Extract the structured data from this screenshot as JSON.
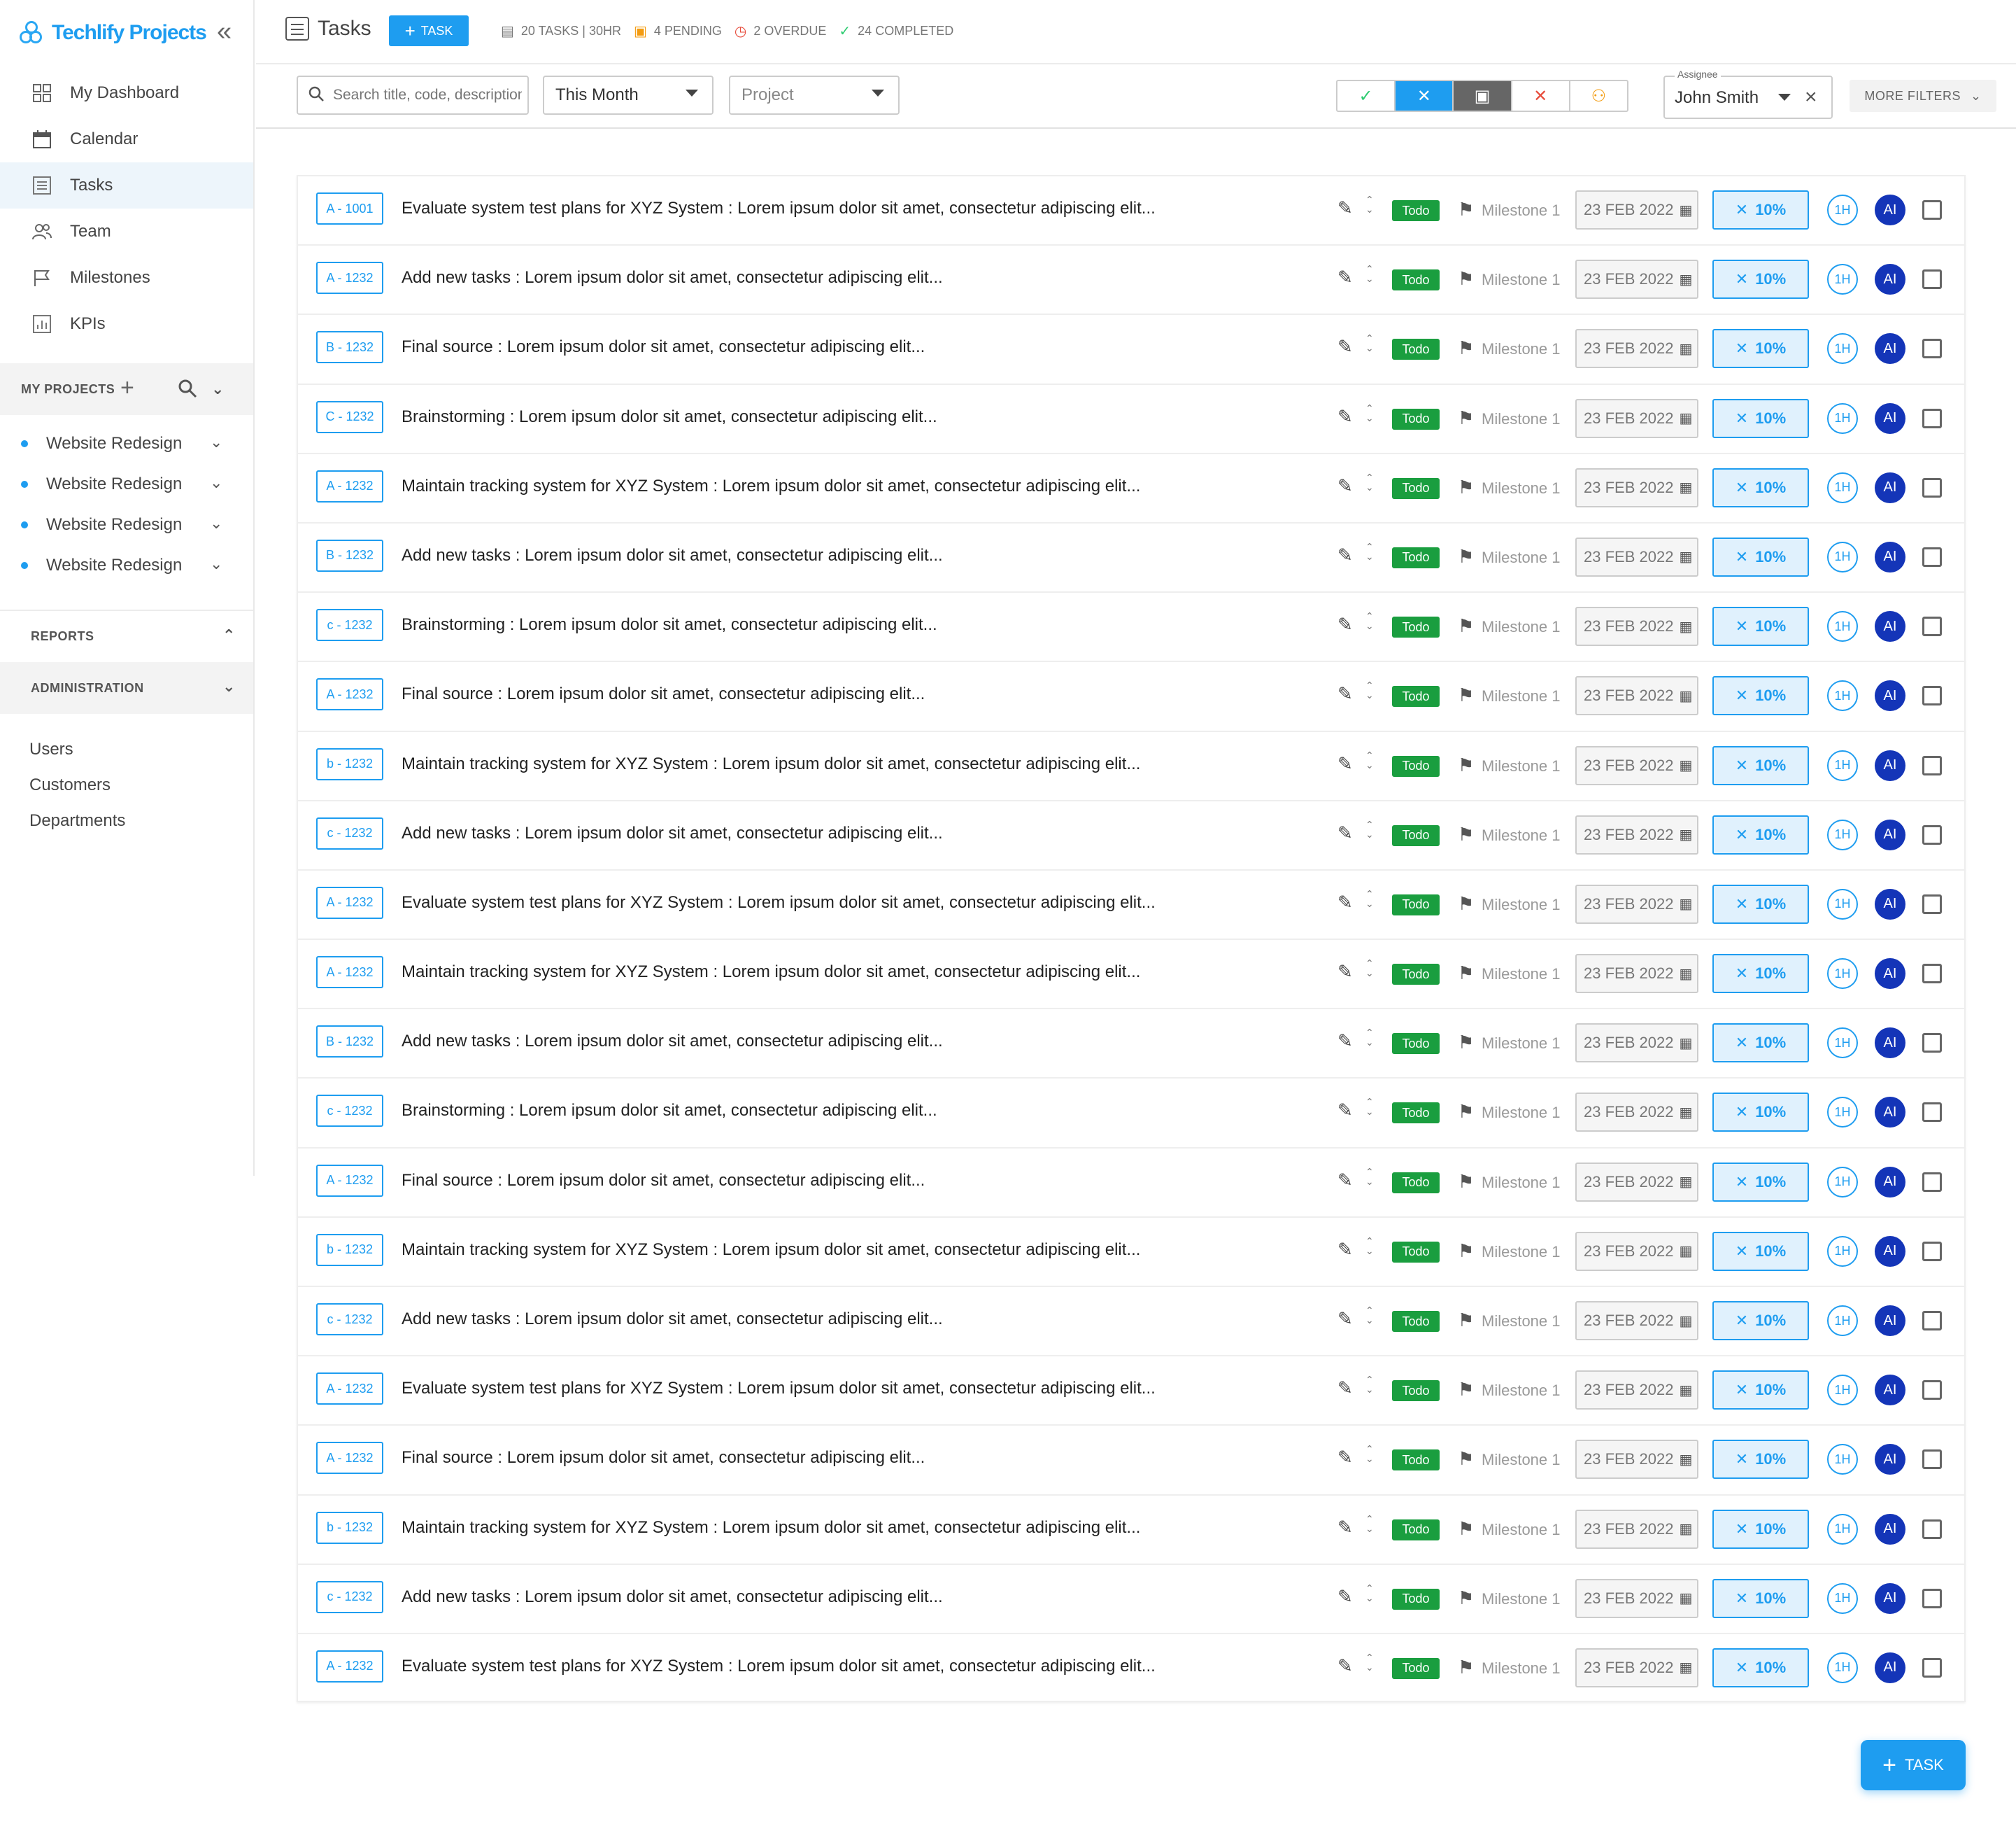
{
  "brand": {
    "name": "Techlify Projects"
  },
  "nav": [
    {
      "label": "My Dashboard",
      "icon": "dashboard-icon"
    },
    {
      "label": "Calendar",
      "icon": "calendar-icon"
    },
    {
      "label": "Tasks",
      "icon": "tasks-icon",
      "active": true
    },
    {
      "label": "Team",
      "icon": "team-icon"
    },
    {
      "label": "Milestones",
      "icon": "milestone-flag-icon"
    },
    {
      "label": "KPIs",
      "icon": "kpi-chart-icon"
    }
  ],
  "my_projects": {
    "label": "MY PROJECTS",
    "items": [
      "Website Redesign",
      "Website Redesign",
      "Website Redesign",
      "Website Redesign"
    ]
  },
  "reports": {
    "label": "REPORTS"
  },
  "administration": {
    "label": "ADMINISTRATION",
    "links": [
      "Users",
      "Customers",
      "Departments"
    ]
  },
  "header": {
    "title": "Tasks",
    "add_task_label": "TASK",
    "stats": {
      "tasks": "20 TASKS | 30HR",
      "pending": "4 PENDING",
      "overdue": "2 OVERDUE",
      "completed": "24 COMPLETED"
    }
  },
  "filters": {
    "search_placeholder": "Search title, code, description",
    "period": "This Month",
    "project_placeholder": "Project",
    "assignee_label": "Assignee",
    "assignee_value": "John Smith",
    "more_filters": "MORE FILTERS"
  },
  "tasks": [
    {
      "code": "A - 1001",
      "title": "Evaluate system test plans for XYZ System : Lorem ipsum dolor sit amet, consectetur adipiscing elit...",
      "status": "Todo",
      "milestone": "Milestone 1",
      "date": "23 FEB 2022",
      "progress": "10%",
      "hours": "1H",
      "assignee": "AI"
    },
    {
      "code": "A - 1232",
      "title": "Add new tasks : Lorem ipsum dolor sit amet, consectetur adipiscing elit...",
      "status": "Todo",
      "milestone": "Milestone 1",
      "date": "23 FEB 2022",
      "progress": "10%",
      "hours": "1H",
      "assignee": "AI"
    },
    {
      "code": "B - 1232",
      "title": "Final source  : Lorem ipsum dolor sit amet, consectetur adipiscing elit...",
      "status": "Todo",
      "milestone": "Milestone 1",
      "date": "23 FEB 2022",
      "progress": "10%",
      "hours": "1H",
      "assignee": "AI"
    },
    {
      "code": "C - 1232",
      "title": "Brainstorming : Lorem ipsum dolor sit amet, consectetur adipiscing elit...",
      "status": "Todo",
      "milestone": "Milestone 1",
      "date": "23 FEB 2022",
      "progress": "10%",
      "hours": "1H",
      "assignee": "AI"
    },
    {
      "code": "A - 1232",
      "title": "Maintain tracking system for XYZ System : Lorem ipsum dolor sit amet, consectetur adipiscing elit...",
      "status": "Todo",
      "milestone": "Milestone 1",
      "date": "23 FEB 2022",
      "progress": "10%",
      "hours": "1H",
      "assignee": "AI"
    },
    {
      "code": "B - 1232",
      "title": "Add new tasks  : Lorem ipsum dolor sit amet, consectetur adipiscing elit...",
      "status": "Todo",
      "milestone": "Milestone 1",
      "date": "23 FEB 2022",
      "progress": "10%",
      "hours": "1H",
      "assignee": "AI"
    },
    {
      "code": "c - 1232",
      "title": "Brainstorming : Lorem ipsum dolor sit amet, consectetur adipiscing elit...",
      "status": "Todo",
      "milestone": "Milestone 1",
      "date": "23 FEB 2022",
      "progress": "10%",
      "hours": "1H",
      "assignee": "AI"
    },
    {
      "code": "A - 1232",
      "title": "Final source  : Lorem ipsum dolor sit amet, consectetur adipiscing elit...",
      "status": "Todo",
      "milestone": "Milestone 1",
      "date": "23 FEB 2022",
      "progress": "10%",
      "hours": "1H",
      "assignee": "AI"
    },
    {
      "code": "b - 1232",
      "title": "Maintain tracking system for XYZ System : Lorem ipsum dolor sit amet, consectetur adipiscing elit...",
      "status": "Todo",
      "milestone": "Milestone 1",
      "date": "23 FEB 2022",
      "progress": "10%",
      "hours": "1H",
      "assignee": "AI"
    },
    {
      "code": "c - 1232",
      "title": "Add new tasks : Lorem ipsum dolor sit amet, consectetur adipiscing elit...",
      "status": "Todo",
      "milestone": "Milestone 1",
      "date": "23 FEB 2022",
      "progress": "10%",
      "hours": "1H",
      "assignee": "AI"
    },
    {
      "code": "A - 1232",
      "title": "Evaluate system test plans for XYZ System : Lorem ipsum dolor sit amet, consectetur adipiscing elit...",
      "status": "Todo",
      "milestone": "Milestone 1",
      "date": "23 FEB 2022",
      "progress": "10%",
      "hours": "1H",
      "assignee": "AI"
    },
    {
      "code": "A - 1232",
      "title": "Maintain tracking system for XYZ System : Lorem ipsum dolor sit amet, consectetur adipiscing elit...",
      "status": "Todo",
      "milestone": "Milestone 1",
      "date": "23 FEB 2022",
      "progress": "10%",
      "hours": "1H",
      "assignee": "AI"
    },
    {
      "code": "B - 1232",
      "title": "Add new tasks  : Lorem ipsum dolor sit amet, consectetur adipiscing elit...",
      "status": "Todo",
      "milestone": "Milestone 1",
      "date": "23 FEB 2022",
      "progress": "10%",
      "hours": "1H",
      "assignee": "AI"
    },
    {
      "code": "c - 1232",
      "title": "Brainstorming : Lorem ipsum dolor sit amet, consectetur adipiscing elit...",
      "status": "Todo",
      "milestone": "Milestone 1",
      "date": "23 FEB 2022",
      "progress": "10%",
      "hours": "1H",
      "assignee": "AI"
    },
    {
      "code": "A - 1232",
      "title": "Final source  : Lorem ipsum dolor sit amet, consectetur adipiscing elit...",
      "status": "Todo",
      "milestone": "Milestone 1",
      "date": "23 FEB 2022",
      "progress": "10%",
      "hours": "1H",
      "assignee": "AI"
    },
    {
      "code": "b - 1232",
      "title": "Maintain tracking system for XYZ System : Lorem ipsum dolor sit amet, consectetur adipiscing elit...",
      "status": "Todo",
      "milestone": "Milestone 1",
      "date": "23 FEB 2022",
      "progress": "10%",
      "hours": "1H",
      "assignee": "AI"
    },
    {
      "code": "c - 1232",
      "title": "Add new tasks : Lorem ipsum dolor sit amet, consectetur adipiscing elit...",
      "status": "Todo",
      "milestone": "Milestone 1",
      "date": "23 FEB 2022",
      "progress": "10%",
      "hours": "1H",
      "assignee": "AI"
    },
    {
      "code": "A - 1232",
      "title": "Evaluate system test plans for XYZ System : Lorem ipsum dolor sit amet, consectetur adipiscing elit...",
      "status": "Todo",
      "milestone": "Milestone 1",
      "date": "23 FEB 2022",
      "progress": "10%",
      "hours": "1H",
      "assignee": "AI"
    },
    {
      "code": "A - 1232",
      "title": "Final source  : Lorem ipsum dolor sit amet, consectetur adipiscing elit...",
      "status": "Todo",
      "milestone": "Milestone 1",
      "date": "23 FEB 2022",
      "progress": "10%",
      "hours": "1H",
      "assignee": "AI"
    },
    {
      "code": "b - 1232",
      "title": "Maintain tracking system for XYZ System : Lorem ipsum dolor sit amet, consectetur adipiscing elit...",
      "status": "Todo",
      "milestone": "Milestone 1",
      "date": "23 FEB 2022",
      "progress": "10%",
      "hours": "1H",
      "assignee": "AI"
    },
    {
      "code": "c - 1232",
      "title": "Add new tasks : Lorem ipsum dolor sit amet, consectetur adipiscing elit...",
      "status": "Todo",
      "milestone": "Milestone 1",
      "date": "23 FEB 2022",
      "progress": "10%",
      "hours": "1H",
      "assignee": "AI"
    },
    {
      "code": "A - 1232",
      "title": "Evaluate system test plans for XYZ System : Lorem ipsum dolor sit amet, consectetur adipiscing elit...",
      "status": "Todo",
      "milestone": "Milestone 1",
      "date": "23 FEB 2022",
      "progress": "10%",
      "hours": "1H",
      "assignee": "AI"
    }
  ],
  "fab": {
    "label": "TASK"
  },
  "colors": {
    "accent": "#1e9df0",
    "status_todo": "#1a9e3f",
    "avatar": "#1435b8",
    "pending": "#f39c12",
    "overdue": "#e74c3c",
    "completed": "#2ecc71"
  }
}
